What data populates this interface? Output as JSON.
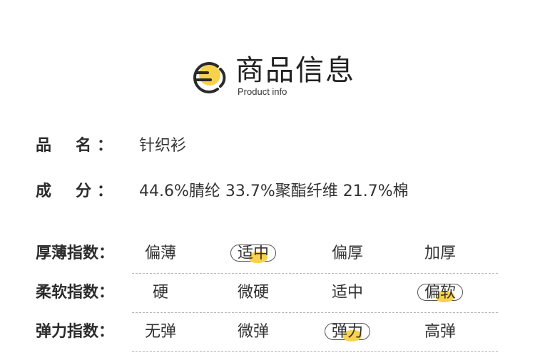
{
  "header": {
    "title": "商品信息",
    "subtitle": "Product info",
    "accent_color": "#f8d24a"
  },
  "info": [
    {
      "label_chars": [
        "品",
        "名"
      ],
      "colon": "：",
      "value": "针织衫"
    },
    {
      "label_chars": [
        "成",
        "分"
      ],
      "colon": "：",
      "value": "44.6%腈纶 33.7%聚酯纤维 21.7%棉"
    }
  ],
  "indexes": [
    {
      "label": "厚薄指数：",
      "options": [
        "偏薄",
        "适中",
        "偏厚",
        "加厚"
      ],
      "selected": 1
    },
    {
      "label": "柔软指数：",
      "options": [
        "硬",
        "微硬",
        "适中",
        "偏软"
      ],
      "selected": 3
    },
    {
      "label": "弹力指数：",
      "options": [
        "无弹",
        "微弹",
        "弹力",
        "高弹"
      ],
      "selected": 2
    }
  ]
}
